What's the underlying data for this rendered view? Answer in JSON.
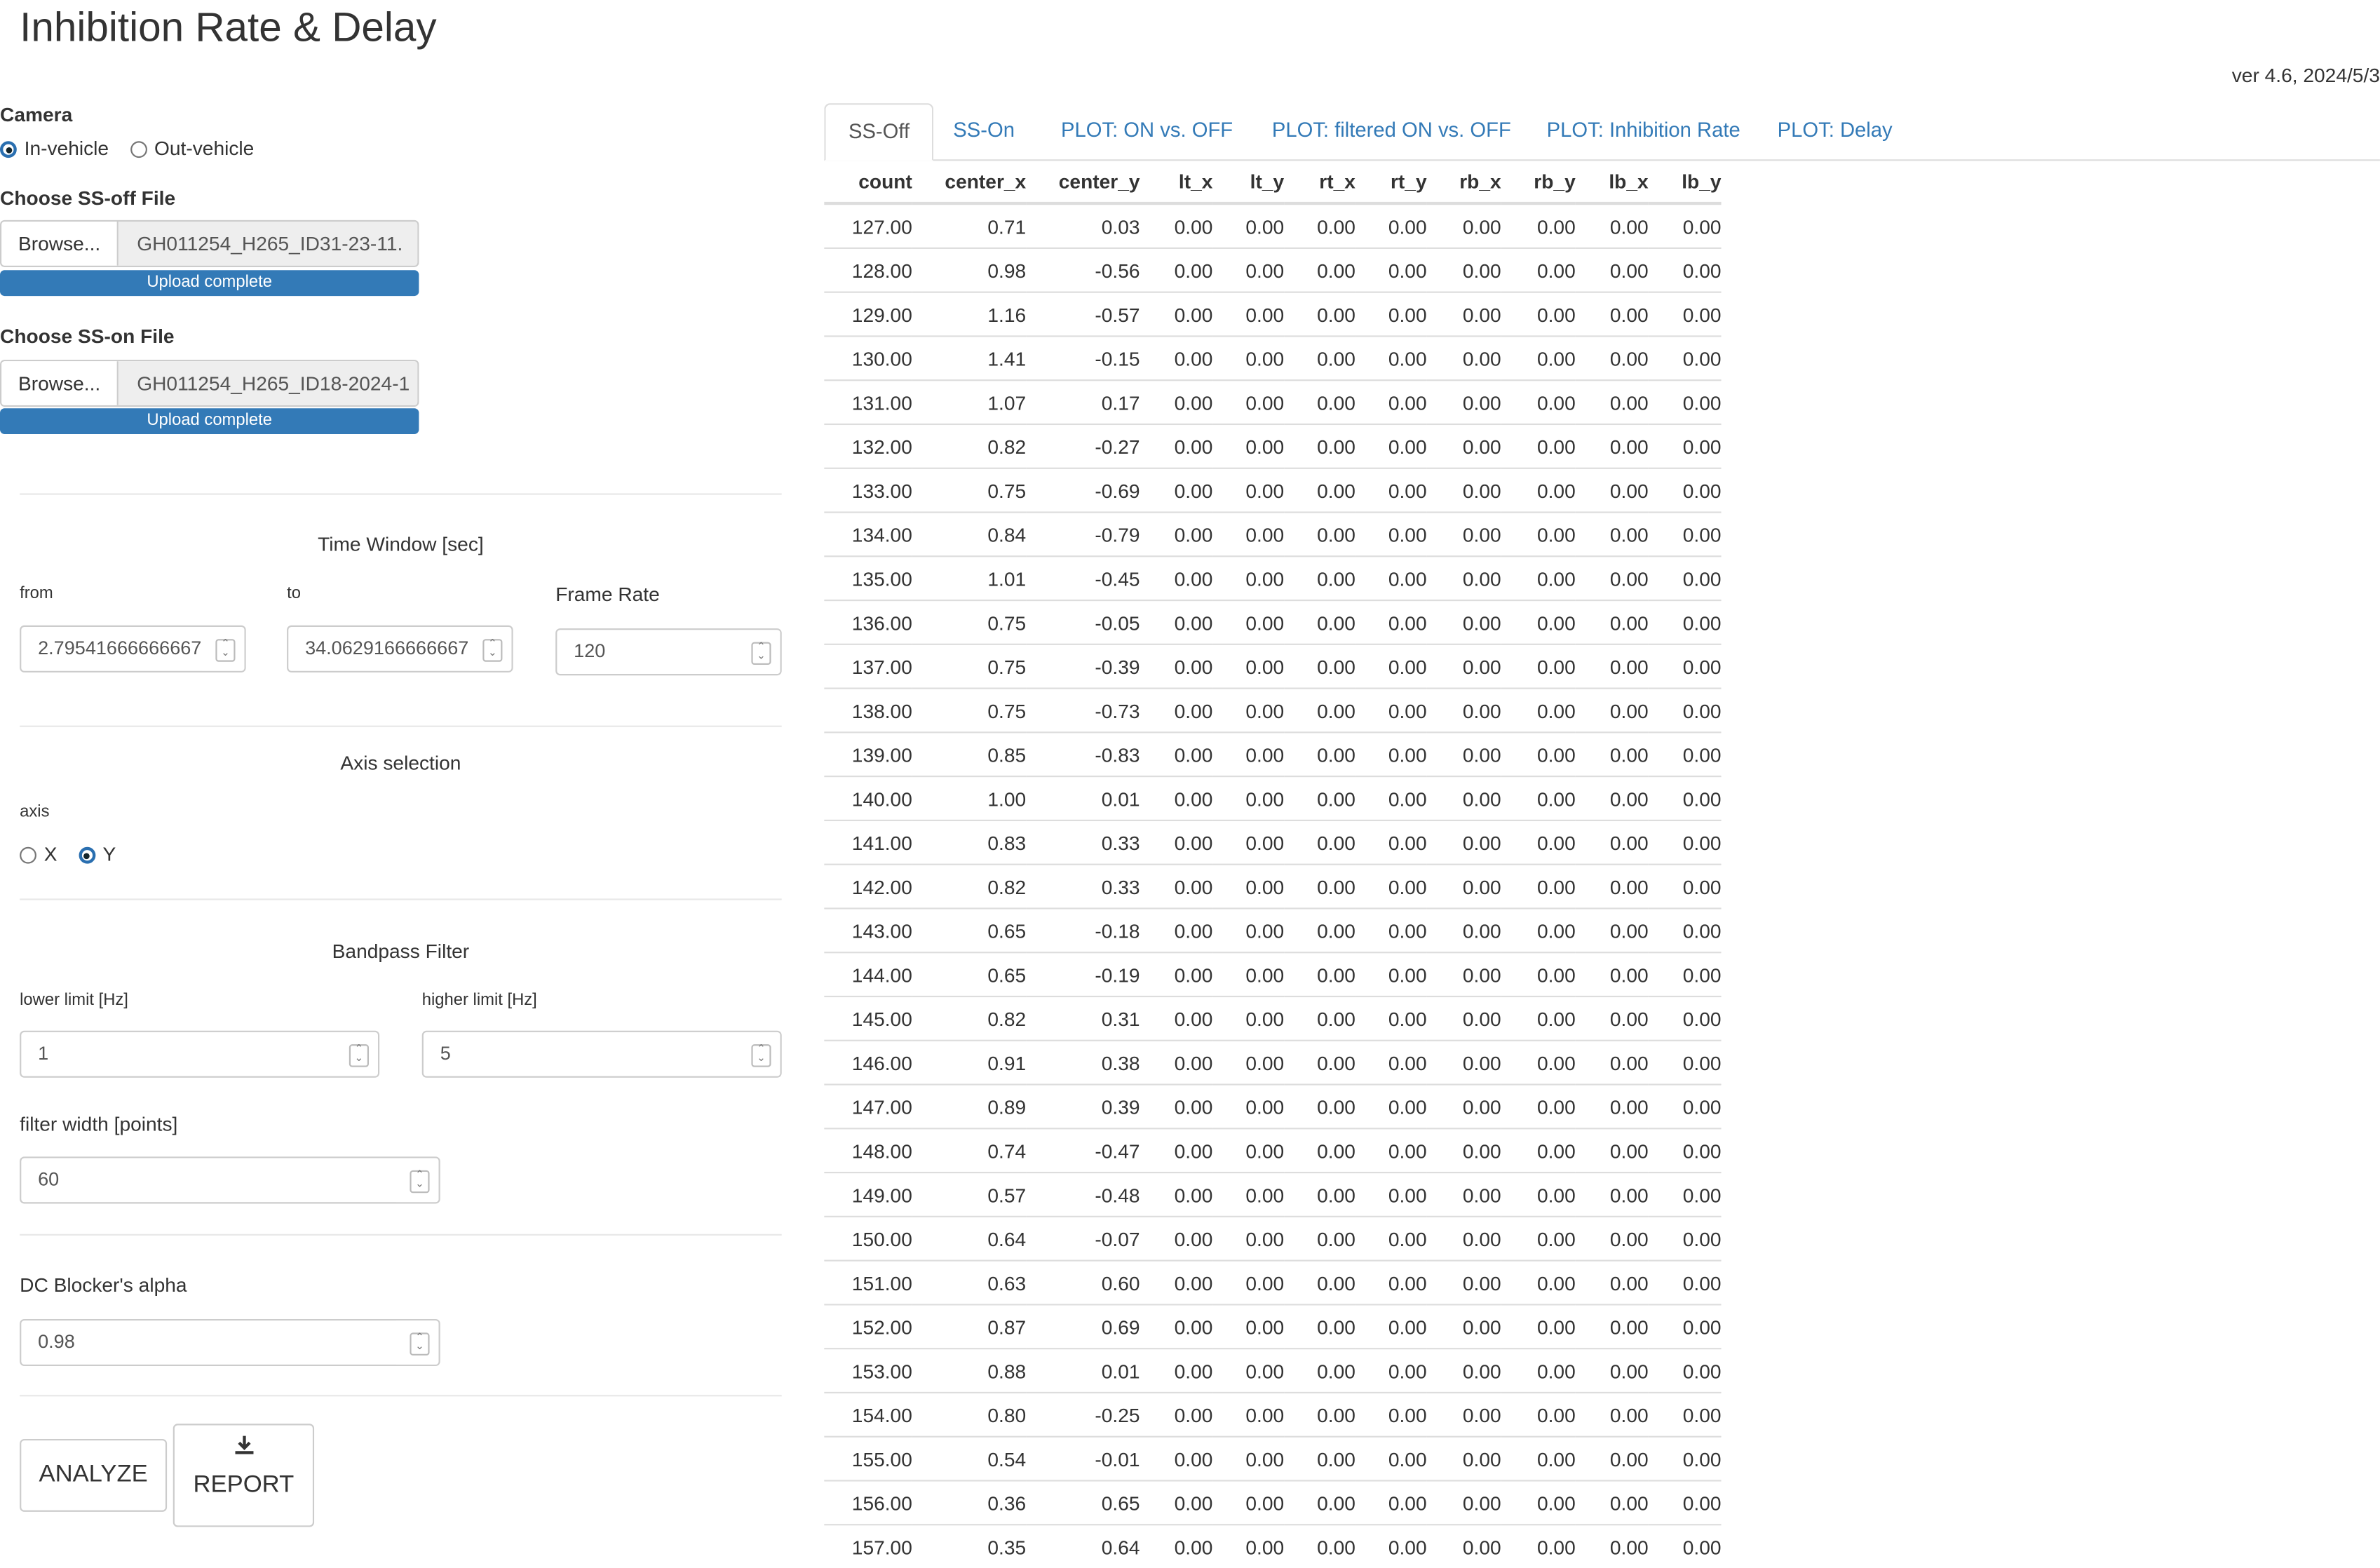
{
  "app": {
    "title": "Inhibition Rate & Delay",
    "version": "ver 4.6, 2024/5/3"
  },
  "camera": {
    "label": "Camera",
    "options": [
      "In-vehicle",
      "Out-vehicle"
    ],
    "selected": "In-vehicle"
  },
  "ss_off_file": {
    "label": "Choose SS-off File",
    "browse": "Browse...",
    "filename": "GH011254_H265_ID31-23-11.",
    "status": "Upload complete"
  },
  "ss_on_file": {
    "label": "Choose SS-on File",
    "browse": "Browse...",
    "filename": "GH011254_H265_ID18-2024-1",
    "status": "Upload complete"
  },
  "time_window": {
    "title": "Time Window [sec]",
    "from_label": "from",
    "from_value": "2.79541666666667",
    "to_label": "to",
    "to_value": "34.0629166666667",
    "frame_rate_label": "Frame Rate",
    "frame_rate_value": "120"
  },
  "axis_selection": {
    "title": "Axis selection",
    "label": "axis",
    "options": [
      "X",
      "Y"
    ],
    "selected": "Y"
  },
  "bandpass": {
    "title": "Bandpass Filter",
    "lower_label": "lower limit [Hz]",
    "lower_value": "1",
    "higher_label": "higher limit [Hz]",
    "higher_value": "5",
    "width_label": "filter width [points]",
    "width_value": "60"
  },
  "dc_blocker": {
    "label": "DC Blocker's alpha",
    "value": "0.98"
  },
  "buttons": {
    "analyze": "ANALYZE",
    "report": "REPORT"
  },
  "tabs": [
    "SS-Off",
    "SS-On",
    "PLOT: ON vs. OFF",
    "PLOT: filtered ON vs. OFF",
    "PLOT: Inhibition Rate",
    "PLOT: Delay"
  ],
  "active_tab": "SS-Off",
  "table": {
    "columns": [
      "count",
      "center_x",
      "center_y",
      "lt_x",
      "lt_y",
      "rt_x",
      "rt_y",
      "rb_x",
      "rb_y",
      "lb_x",
      "lb_y"
    ],
    "rows": [
      [
        "127.00",
        "0.71",
        "0.03",
        "0.00",
        "0.00",
        "0.00",
        "0.00",
        "0.00",
        "0.00",
        "0.00",
        "0.00"
      ],
      [
        "128.00",
        "0.98",
        "-0.56",
        "0.00",
        "0.00",
        "0.00",
        "0.00",
        "0.00",
        "0.00",
        "0.00",
        "0.00"
      ],
      [
        "129.00",
        "1.16",
        "-0.57",
        "0.00",
        "0.00",
        "0.00",
        "0.00",
        "0.00",
        "0.00",
        "0.00",
        "0.00"
      ],
      [
        "130.00",
        "1.41",
        "-0.15",
        "0.00",
        "0.00",
        "0.00",
        "0.00",
        "0.00",
        "0.00",
        "0.00",
        "0.00"
      ],
      [
        "131.00",
        "1.07",
        "0.17",
        "0.00",
        "0.00",
        "0.00",
        "0.00",
        "0.00",
        "0.00",
        "0.00",
        "0.00"
      ],
      [
        "132.00",
        "0.82",
        "-0.27",
        "0.00",
        "0.00",
        "0.00",
        "0.00",
        "0.00",
        "0.00",
        "0.00",
        "0.00"
      ],
      [
        "133.00",
        "0.75",
        "-0.69",
        "0.00",
        "0.00",
        "0.00",
        "0.00",
        "0.00",
        "0.00",
        "0.00",
        "0.00"
      ],
      [
        "134.00",
        "0.84",
        "-0.79",
        "0.00",
        "0.00",
        "0.00",
        "0.00",
        "0.00",
        "0.00",
        "0.00",
        "0.00"
      ],
      [
        "135.00",
        "1.01",
        "-0.45",
        "0.00",
        "0.00",
        "0.00",
        "0.00",
        "0.00",
        "0.00",
        "0.00",
        "0.00"
      ],
      [
        "136.00",
        "0.75",
        "-0.05",
        "0.00",
        "0.00",
        "0.00",
        "0.00",
        "0.00",
        "0.00",
        "0.00",
        "0.00"
      ],
      [
        "137.00",
        "0.75",
        "-0.39",
        "0.00",
        "0.00",
        "0.00",
        "0.00",
        "0.00",
        "0.00",
        "0.00",
        "0.00"
      ],
      [
        "138.00",
        "0.75",
        "-0.73",
        "0.00",
        "0.00",
        "0.00",
        "0.00",
        "0.00",
        "0.00",
        "0.00",
        "0.00"
      ],
      [
        "139.00",
        "0.85",
        "-0.83",
        "0.00",
        "0.00",
        "0.00",
        "0.00",
        "0.00",
        "0.00",
        "0.00",
        "0.00"
      ],
      [
        "140.00",
        "1.00",
        "0.01",
        "0.00",
        "0.00",
        "0.00",
        "0.00",
        "0.00",
        "0.00",
        "0.00",
        "0.00"
      ],
      [
        "141.00",
        "0.83",
        "0.33",
        "0.00",
        "0.00",
        "0.00",
        "0.00",
        "0.00",
        "0.00",
        "0.00",
        "0.00"
      ],
      [
        "142.00",
        "0.82",
        "0.33",
        "0.00",
        "0.00",
        "0.00",
        "0.00",
        "0.00",
        "0.00",
        "0.00",
        "0.00"
      ],
      [
        "143.00",
        "0.65",
        "-0.18",
        "0.00",
        "0.00",
        "0.00",
        "0.00",
        "0.00",
        "0.00",
        "0.00",
        "0.00"
      ],
      [
        "144.00",
        "0.65",
        "-0.19",
        "0.00",
        "0.00",
        "0.00",
        "0.00",
        "0.00",
        "0.00",
        "0.00",
        "0.00"
      ],
      [
        "145.00",
        "0.82",
        "0.31",
        "0.00",
        "0.00",
        "0.00",
        "0.00",
        "0.00",
        "0.00",
        "0.00",
        "0.00"
      ],
      [
        "146.00",
        "0.91",
        "0.38",
        "0.00",
        "0.00",
        "0.00",
        "0.00",
        "0.00",
        "0.00",
        "0.00",
        "0.00"
      ],
      [
        "147.00",
        "0.89",
        "0.39",
        "0.00",
        "0.00",
        "0.00",
        "0.00",
        "0.00",
        "0.00",
        "0.00",
        "0.00"
      ],
      [
        "148.00",
        "0.74",
        "-0.47",
        "0.00",
        "0.00",
        "0.00",
        "0.00",
        "0.00",
        "0.00",
        "0.00",
        "0.00"
      ],
      [
        "149.00",
        "0.57",
        "-0.48",
        "0.00",
        "0.00",
        "0.00",
        "0.00",
        "0.00",
        "0.00",
        "0.00",
        "0.00"
      ],
      [
        "150.00",
        "0.64",
        "-0.07",
        "0.00",
        "0.00",
        "0.00",
        "0.00",
        "0.00",
        "0.00",
        "0.00",
        "0.00"
      ],
      [
        "151.00",
        "0.63",
        "0.60",
        "0.00",
        "0.00",
        "0.00",
        "0.00",
        "0.00",
        "0.00",
        "0.00",
        "0.00"
      ],
      [
        "152.00",
        "0.87",
        "0.69",
        "0.00",
        "0.00",
        "0.00",
        "0.00",
        "0.00",
        "0.00",
        "0.00",
        "0.00"
      ],
      [
        "153.00",
        "0.88",
        "0.01",
        "0.00",
        "0.00",
        "0.00",
        "0.00",
        "0.00",
        "0.00",
        "0.00",
        "0.00"
      ],
      [
        "154.00",
        "0.80",
        "-0.25",
        "0.00",
        "0.00",
        "0.00",
        "0.00",
        "0.00",
        "0.00",
        "0.00",
        "0.00"
      ],
      [
        "155.00",
        "0.54",
        "-0.01",
        "0.00",
        "0.00",
        "0.00",
        "0.00",
        "0.00",
        "0.00",
        "0.00",
        "0.00"
      ],
      [
        "156.00",
        "0.36",
        "0.65",
        "0.00",
        "0.00",
        "0.00",
        "0.00",
        "0.00",
        "0.00",
        "0.00",
        "0.00"
      ],
      [
        "157.00",
        "0.35",
        "0.64",
        "0.00",
        "0.00",
        "0.00",
        "0.00",
        "0.00",
        "0.00",
        "0.00",
        "0.00"
      ]
    ]
  },
  "colors": {
    "link": "#337ab7",
    "progress": "#337ab7",
    "radio_checked": "#2a6fb0"
  },
  "icons": {
    "report": "download-icon",
    "spinner": "spinner-arrows-icon"
  }
}
